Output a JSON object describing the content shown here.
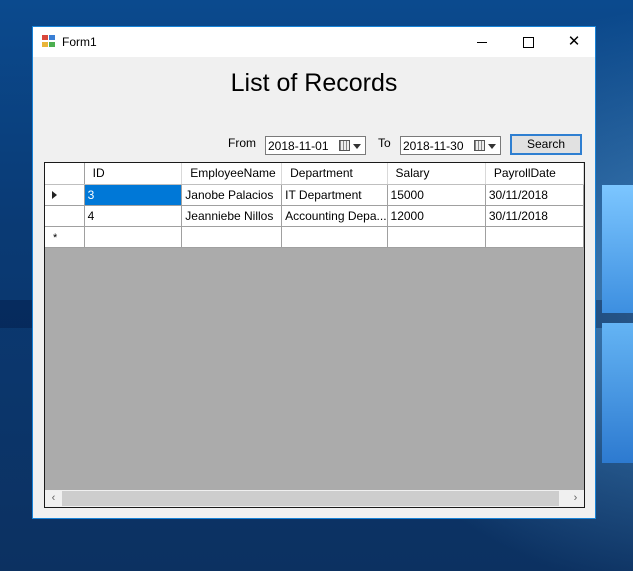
{
  "window": {
    "title": "Form1",
    "minimize_glyph": "minimize",
    "maximize_glyph": "maximize",
    "close_glyph": "✕"
  },
  "heading": "List of Records",
  "filter": {
    "from_label": "From",
    "from_value": "2018-11-01",
    "to_label": "To",
    "to_value": "2018-11-30",
    "search_label": "Search"
  },
  "grid": {
    "columns": [
      "ID",
      "EmployeeName",
      "Department",
      "Salary",
      "PayrollDate"
    ],
    "rows": [
      [
        "3",
        "Janobe Palacios",
        "IT Department",
        "15000",
        "30/11/2018"
      ],
      [
        "4",
        "Jeanniebe Nillos",
        "Accounting Depa...",
        "12000",
        "30/11/2018"
      ]
    ],
    "new_row_marker": "*"
  },
  "scrollbar": {
    "left_arrow": "‹",
    "right_arrow": "›"
  },
  "colors": {
    "selection": "#0078d7",
    "window_border": "#1883d7",
    "grid_empty_area": "#ababab"
  },
  "icons": {
    "app": "form-app-icon",
    "calendar": "calendar-icon",
    "dropdown": "chevron-down-icon",
    "current_row": "row-pointer-icon"
  }
}
